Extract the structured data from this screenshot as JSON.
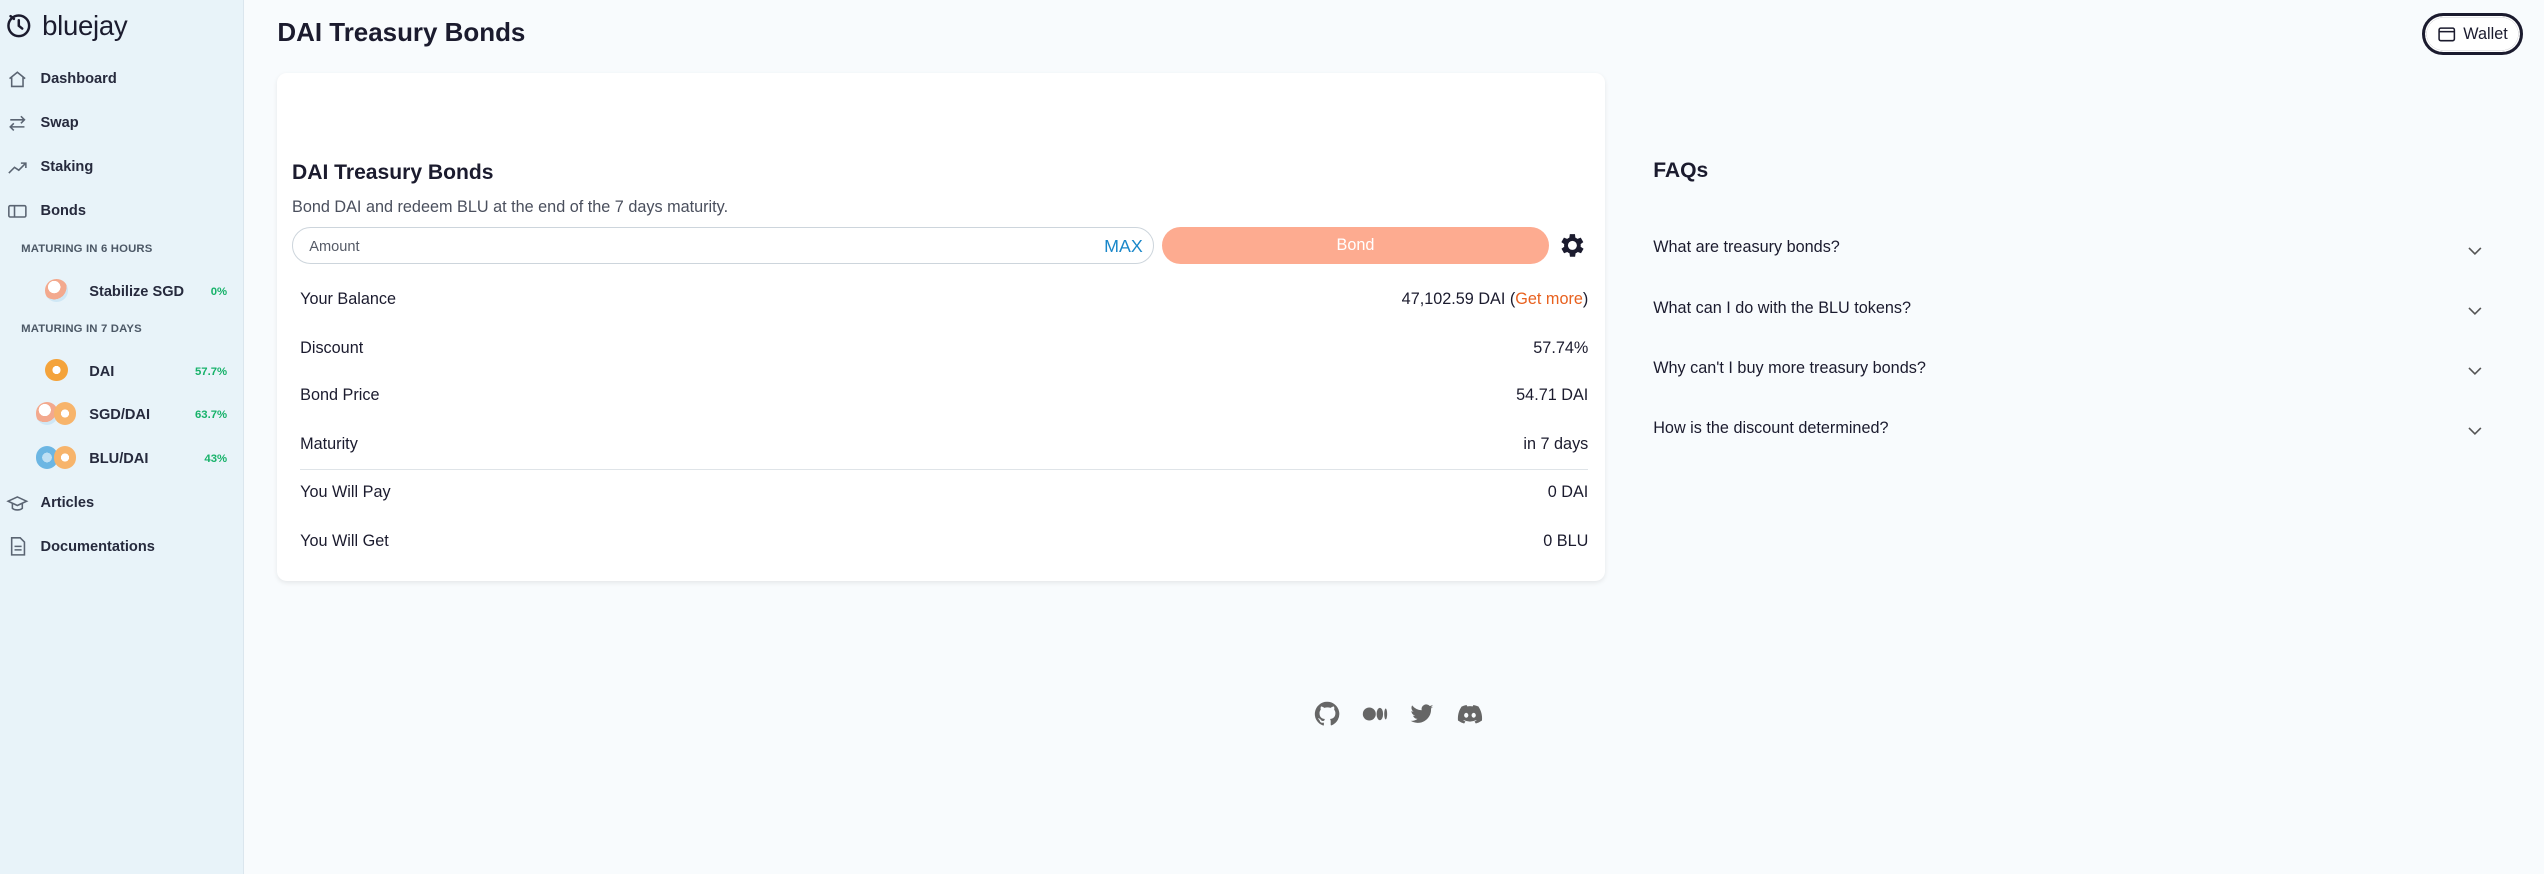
{
  "app": {
    "name": "bluejay"
  },
  "colors": {
    "accent": "#fdab90",
    "link": "#1a87c9",
    "positive": "#17b26a",
    "get_more": "#e8611f"
  },
  "sidebar": {
    "nav": [
      {
        "label": "Dashboard",
        "icon": "home-icon"
      },
      {
        "label": "Swap",
        "icon": "swap-icon"
      },
      {
        "label": "Staking",
        "icon": "trend-icon"
      },
      {
        "label": "Bonds",
        "icon": "ticket-icon"
      }
    ],
    "bond_sections": [
      {
        "title": "MATURING IN 6 HOURS",
        "items": [
          {
            "name": "Stabilize SGD",
            "pct": "0%"
          }
        ]
      },
      {
        "title": "MATURING IN 7 DAYS",
        "items": [
          {
            "name": "DAI",
            "pct": "57.7%"
          },
          {
            "name": "SGD/DAI",
            "pct": "63.7%"
          },
          {
            "name": "BLU/DAI",
            "pct": "43%"
          }
        ]
      }
    ],
    "bottom_nav": [
      {
        "label": "Articles",
        "icon": "graduation-cap-icon"
      },
      {
        "label": "Documentations",
        "icon": "document-icon"
      }
    ]
  },
  "header": {
    "title": "DAI Treasury Bonds",
    "wallet_label": "Wallet"
  },
  "bond_card": {
    "title": "DAI Treasury Bonds",
    "subtitle": "Bond DAI and redeem BLU at the end of the 7 days maturity.",
    "amount_placeholder": "Amount",
    "max_label": "MAX",
    "bond_label": "Bond",
    "rows": [
      {
        "label": "Your Balance",
        "value": "47,102.59 DAI (",
        "link": "Get more",
        "suffix": ")"
      },
      {
        "label": "Discount",
        "value": "57.74%"
      },
      {
        "label": "Bond Price",
        "value": "54.71 DAI"
      },
      {
        "label": "Maturity",
        "value": "in 7 days"
      },
      {
        "label": "You Will Pay",
        "value": "0 DAI"
      },
      {
        "label": "You Will Get",
        "value": "0 BLU"
      }
    ]
  },
  "faq": {
    "title": "FAQs",
    "items": [
      "What are treasury bonds?",
      "What can I do with the BLU tokens?",
      "Why can't I buy more treasury bonds?",
      "How is the discount determined?"
    ]
  },
  "footer": {
    "icons": [
      "github-icon",
      "medium-icon",
      "twitter-icon",
      "discord-icon"
    ]
  }
}
